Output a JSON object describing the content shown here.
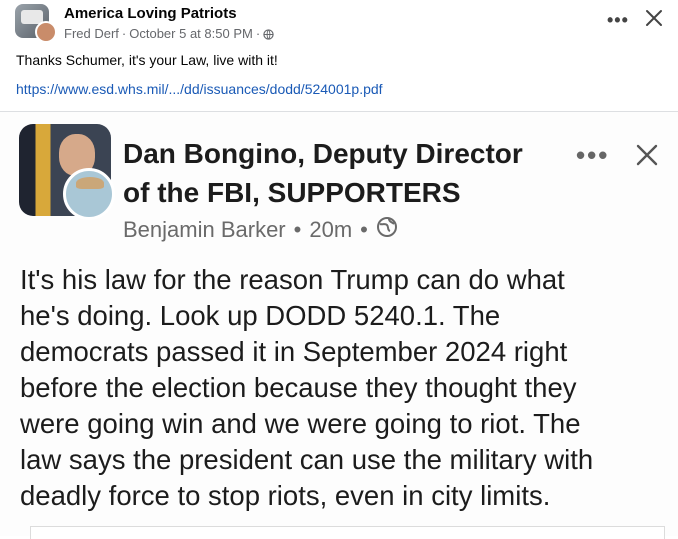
{
  "post": {
    "group_name": "America Loving Patriots",
    "author": "Fred Derf",
    "separator": "·",
    "timestamp": "October 5 at 8:50 PM",
    "privacy_separator": "·",
    "privacy_icon": "globe-icon",
    "more_icon": "more-options-icon",
    "close_icon": "close-icon",
    "more_glyph": "•••",
    "caption": "Thanks Schumer, it's your Law, live with it!",
    "link": "https://www.esd.whs.mil/.../dd/issuances/dodd/524001p.pdf"
  },
  "shared_post": {
    "title_line1": "Dan Bongino, Deputy Director",
    "title_line2": "of the FBI, SUPPORTERS",
    "author": "Benjamin Barker",
    "dot1": "•",
    "time": "20m",
    "dot2": "•",
    "privacy_icon": "globe-icon",
    "more_glyph": "•••",
    "body_lines": [
      "It's his law for the reason Trump can do what",
      "he's doing. Look up DODD 5240.1. The",
      "democrats passed it in September 2024 right",
      "before the election because they thought they",
      "were going win and we were going to riot. The",
      "law says the president can use the military with",
      "deadly force to stop riots, even in city limits."
    ]
  },
  "colors": {
    "link": "#1a5ab6",
    "meta": "#65676b",
    "text": "#050505"
  }
}
